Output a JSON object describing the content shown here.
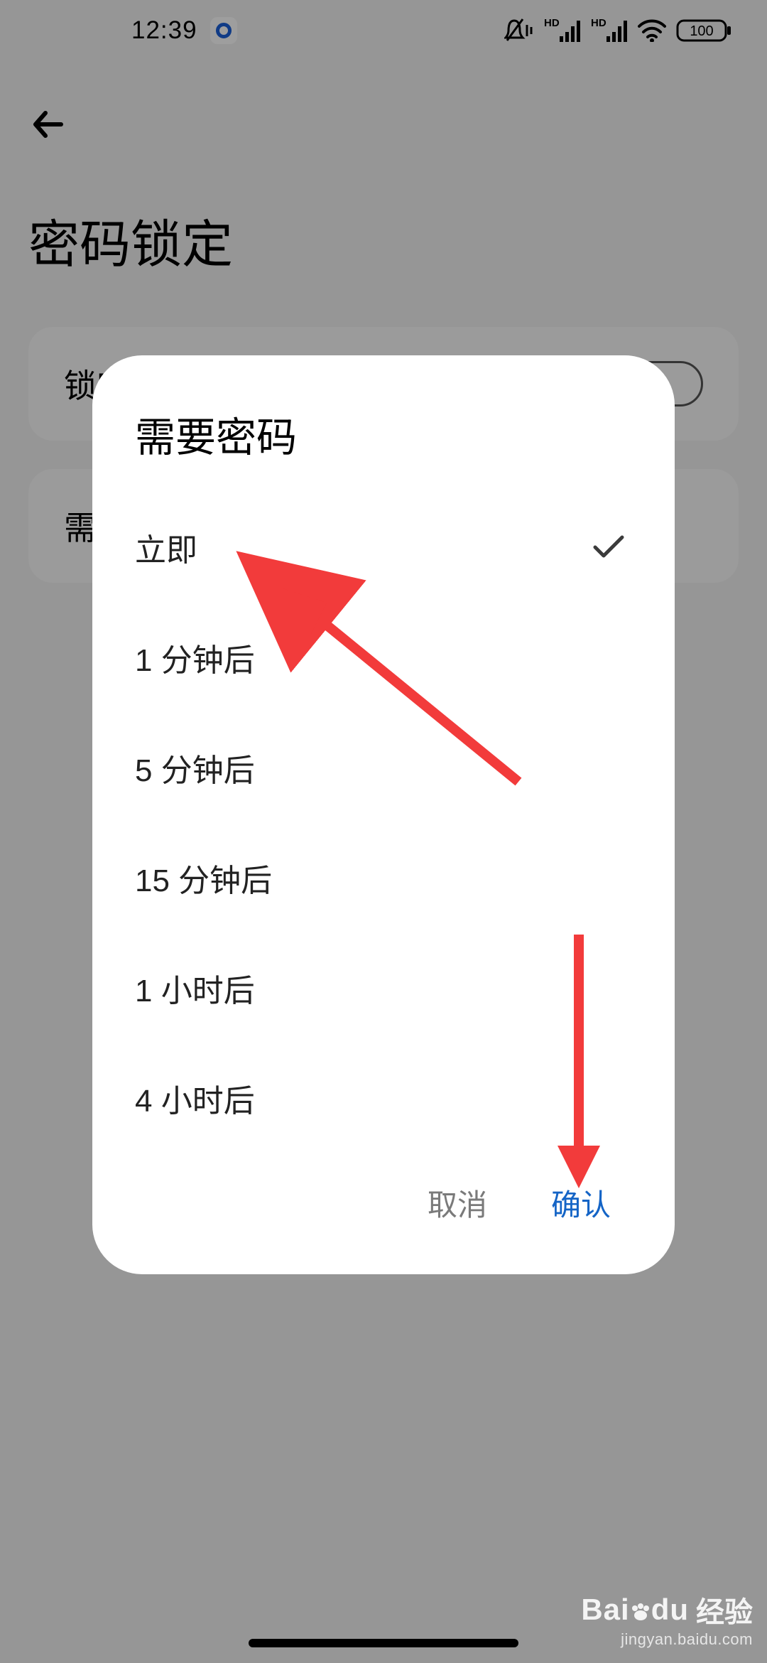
{
  "status_bar": {
    "time": "12:39",
    "battery": "100"
  },
  "page": {
    "title": "密码锁定",
    "settings": [
      {
        "label": "锁定屏幕",
        "toggle_on": false
      },
      {
        "label": "需要密码"
      }
    ]
  },
  "dialog": {
    "title": "需要密码",
    "options": [
      {
        "label": "立即",
        "selected": true
      },
      {
        "label": "1 分钟后",
        "selected": false
      },
      {
        "label": "5 分钟后",
        "selected": false
      },
      {
        "label": "15 分钟后",
        "selected": false
      },
      {
        "label": "1 小时后",
        "selected": false
      },
      {
        "label": "4 小时后",
        "selected": false
      }
    ],
    "cancel": "取消",
    "confirm": "确认"
  },
  "watermark": {
    "main": "Bai",
    "du": "du",
    "jingyan": "经验",
    "sub": "jingyan.baidu.com"
  }
}
